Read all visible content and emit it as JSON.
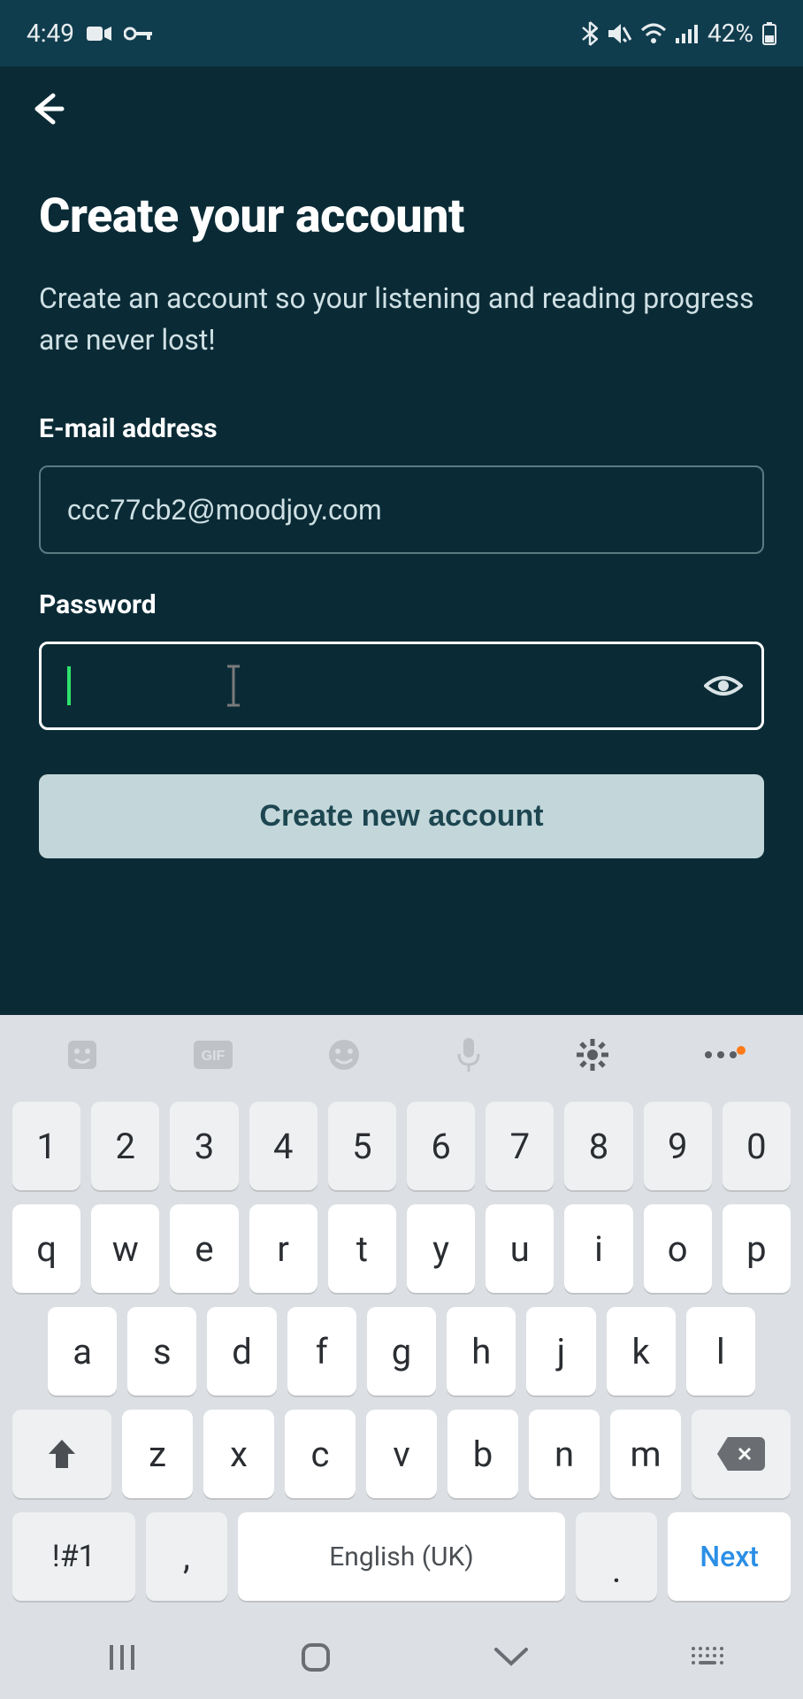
{
  "status": {
    "time": "4:49",
    "battery_text": "42%"
  },
  "page": {
    "title": "Create your account",
    "subtitle": "Create an account so your listening and reading progress are never lost!"
  },
  "form": {
    "email_label": "E-mail address",
    "email_value": "ccc77cb2@moodjoy.com",
    "password_label": "Password",
    "password_value": "",
    "submit_label": "Create new account"
  },
  "keyboard": {
    "rows": {
      "num": [
        "1",
        "2",
        "3",
        "4",
        "5",
        "6",
        "7",
        "8",
        "9",
        "0"
      ],
      "r1": [
        "q",
        "w",
        "e",
        "r",
        "t",
        "y",
        "u",
        "i",
        "o",
        "p"
      ],
      "r2": [
        "a",
        "s",
        "d",
        "f",
        "g",
        "h",
        "j",
        "k",
        "l"
      ],
      "r3": [
        "z",
        "x",
        "c",
        "v",
        "b",
        "n",
        "m"
      ]
    },
    "sym_label": "!#1",
    "comma_label": ",",
    "period_label": ".",
    "space_label": "English (UK)",
    "next_label": "Next"
  }
}
